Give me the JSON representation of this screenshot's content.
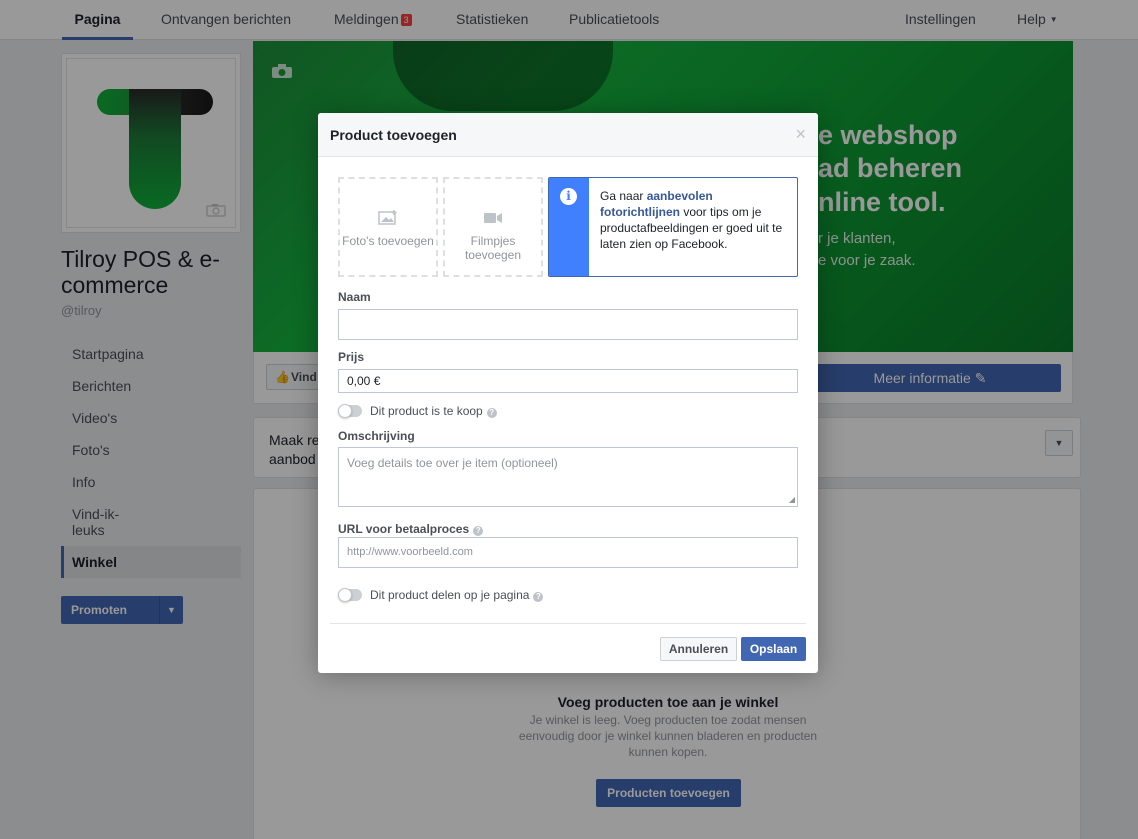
{
  "nav": {
    "tabs": [
      "Pagina",
      "Ontvangen berichten",
      "Meldingen",
      "Statistieken",
      "Publicatietools"
    ],
    "notifications_badge": "3",
    "settings": "Instellingen",
    "help": "Help"
  },
  "page": {
    "name": "Tilroy POS & e-commerce",
    "handle": "@tilroy"
  },
  "sidebar": {
    "items": [
      {
        "label": "Startpagina"
      },
      {
        "label": "Berichten"
      },
      {
        "label": "Video's"
      },
      {
        "label": "Foto's"
      },
      {
        "label": "Info"
      },
      {
        "label": "Vind-ik-leuks"
      },
      {
        "label": "Winkel"
      }
    ],
    "promote": "Promoten"
  },
  "cover": {
    "line1": "e webshop",
    "line2": "ad beheren",
    "line3": "nline tool.",
    "sub1": "r je klanten,",
    "sub2": "e voor je zaak."
  },
  "actions": {
    "like": "Vind",
    "more_info": "Meer informatie"
  },
  "card": {
    "text_line1": "Maak re",
    "text_line2": "aanbod"
  },
  "shop": {
    "empty_title": "Voeg producten toe aan je winkel",
    "empty_desc": "Je winkel is leeg. Voeg producten toe zodat mensen eenvoudig door je winkel kunnen bladeren en producten kunnen kopen.",
    "add_button": "Producten toevoegen"
  },
  "modal": {
    "title": "Product toevoegen",
    "photos": "Foto's toevoegen",
    "videos": "Filmpjes toevoegen",
    "info_pre": "Ga naar ",
    "info_link": "aanbevolen fotorichtlijnen",
    "info_post": " voor tips om je productafbeeldingen er goed uit te laten zien op Facebook.",
    "name_label": "Naam",
    "name_value": "",
    "price_label": "Prijs",
    "price_value": "0,00 €",
    "for_sale": "Dit product is te koop",
    "description_label": "Omschrijving",
    "description_placeholder": "Voeg details toe over je item (optioneel)",
    "url_label": "URL voor betaalproces",
    "url_placeholder": "http://www.voorbeeld.com",
    "share": "Dit product delen op je pagina",
    "cancel": "Annuleren",
    "save": "Opslaan"
  }
}
